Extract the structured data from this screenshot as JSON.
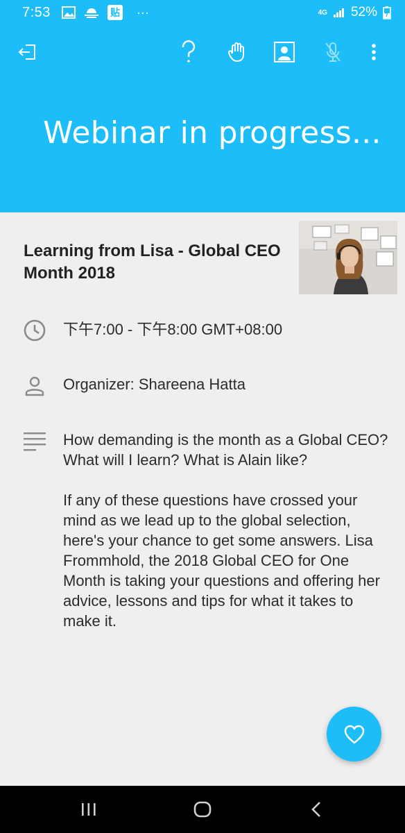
{
  "status_bar": {
    "time": "7:53",
    "app_icon_label": "贴",
    "more": "···",
    "network": "4G",
    "battery_percent": "52%"
  },
  "toolbar": {
    "icons": [
      "exit-icon",
      "help-icon",
      "raise-hand-icon",
      "attendee-icon",
      "mic-muted-icon",
      "more-vert-icon"
    ]
  },
  "header": {
    "title": "Webinar in progress..."
  },
  "event": {
    "title": "Learning from Lisa - Global CEO Month 2018",
    "time": "下午7:00 - 下午8:00 GMT+08:00",
    "organizer": "Organizer: Shareena Hatta",
    "description_p1": "How demanding is the month as a Global CEO? What will I learn? What is Alain like?",
    "description_p2": "If any of these questions have crossed your mind as we lead up to the global selection, here's your chance to get some answers. Lisa Frommhold, the 2018 Global CEO for One Month is taking your questions and offering her advice, lessons and tips for what it takes to make it."
  },
  "colors": {
    "accent": "#1cbdf8",
    "background": "#efefef",
    "text": "#2b2b2b"
  }
}
